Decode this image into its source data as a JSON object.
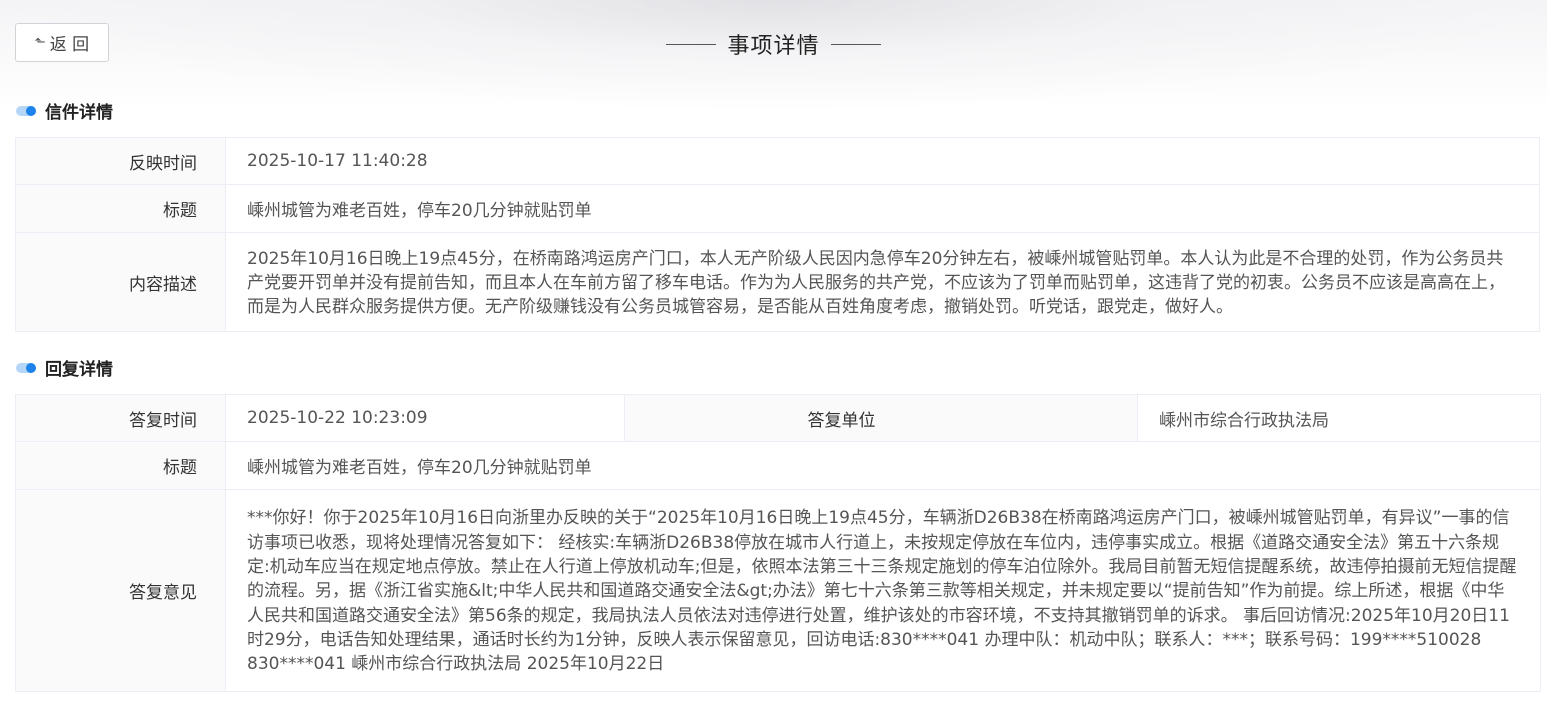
{
  "header": {
    "back_label": "返 回",
    "back_icon": "back-arrow-icon",
    "title": "事项详情"
  },
  "letter": {
    "section_title": "信件详情",
    "rows": [
      {
        "label": "反映时间",
        "value": "2025-10-17 11:40:28"
      },
      {
        "label": "标题",
        "value": "嵊州城管为难老百姓，停车20几分钟就贴罚单"
      },
      {
        "label": "内容描述",
        "value": "2025年10月16日晚上19点45分，在桥南路鸿运房产门口，本人无产阶级人民因内急停车20分钟左右，被嵊州城管贴罚单。本人认为此是不合理的处罚，作为公务员共产党要开罚单并没有提前告知，而且本人在车前方留了移车电话。作为为人民服务的共产党，不应该为了罚单而贴罚单，这违背了党的初衷。公务员不应该是高高在上，而是为人民群众服务提供方便。无产阶级赚钱没有公务员城管容易，是否能从百姓角度考虑，撤销处罚。听党话，跟党走，做好人。"
      }
    ]
  },
  "reply": {
    "section_title": "回复详情",
    "time_label": "答复时间",
    "time_value": "2025-10-22 10:23:09",
    "unit_label": "答复单位",
    "unit_value": "嵊州市综合行政执法局",
    "title_label": "标题",
    "title_value": "嵊州城管为难老百姓，停车20几分钟就贴罚单",
    "opinion_label": "答复意见",
    "opinion_value": "***你好！你于2025年10月16日向浙里办反映的关于“2025年10月16日晚上19点45分，车辆浙D26B38在桥南路鸿运房产门口，被嵊州城管贴罚单，有异议”一事的信访事项已收悉，现将处理情况答复如下： 经核实:车辆浙D26B38停放在城市人行道上，未按规定停放在车位内，违停事实成立。根据《道路交通安全法》第五十六条规定:机动车应当在规定地点停放。禁止在人行道上停放机动车;但是，依照本法第三十三条规定施划的停车泊位除外。我局目前暂无短信提醒系统，故违停拍摄前无短信提醒的流程。另，据《浙江省实施&lt;中华人民共和国道路交通安全法&gt;办法》第七十六条第三款等相关规定，并未规定要以“提前告知”作为前提。综上所述，根据《中华人民共和国道路交通安全法》第56条的规定，我局执法人员依法对违停进行处置，维护该处的市容环境，不支持其撤销罚单的诉求。 事后回访情况:2025年10月20日11时29分，电话告知处理结果，通话时长约为1分钟，反映人表示保留意见，回访电话:830****041 办理中队：机动中队；联系人：***；联系号码：199****510028 830****041 嵊州市综合行政执法局 2025年10月22日"
  }
}
